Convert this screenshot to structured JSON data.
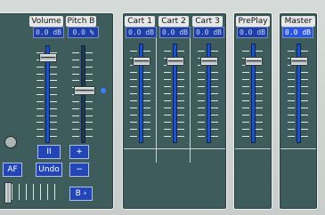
{
  "colors": {
    "panel": "#3f5c5c",
    "readout_bg": "#1e3fa8",
    "accent": "#2346b7",
    "track": "#1b52c8"
  },
  "left_panel": {
    "volume_b": {
      "header": "Volume B",
      "readout": "0.0 dB"
    },
    "pitch_b": {
      "header": "Pitch B",
      "readout": "0.0 %"
    },
    "buttons": {
      "pause": "II",
      "plus": "+",
      "af": "AF",
      "undo": "Undo",
      "minus": "−",
      "b_next": "B ›"
    }
  },
  "carts": [
    {
      "header": "Cart 1",
      "readout": "0.0 dB"
    },
    {
      "header": "Cart 2",
      "readout": "0.0 dB"
    },
    {
      "header": "Cart 3",
      "readout": "0.0 dB"
    }
  ],
  "preplay": {
    "header": "PrePlay",
    "readout": "0.0 dB"
  },
  "master": {
    "header": "Master",
    "readout": "0.0 dB"
  }
}
